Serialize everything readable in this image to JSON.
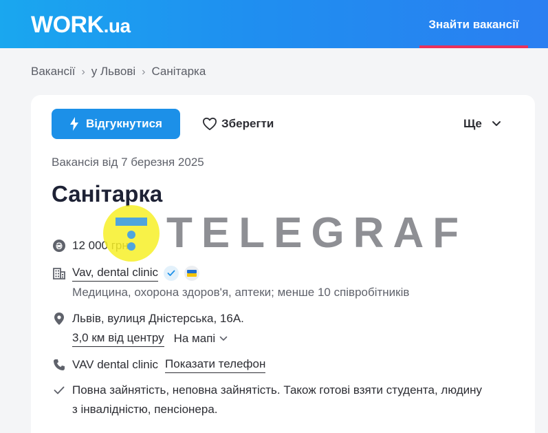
{
  "header": {
    "logo_main": "WORK",
    "logo_suffix": ".ua",
    "nav_find": "Знайти вакансії",
    "accent_color": "#e8315b"
  },
  "breadcrumb": {
    "items": [
      "Вакансії",
      "у Львові",
      "Санітарка"
    ],
    "separator": "›"
  },
  "actions": {
    "apply_label": "Відгукнутися",
    "save_label": "Зберегти",
    "more_label": "Ще"
  },
  "vacancy": {
    "posted": "Вакансія від 7 березня 2025",
    "title": "Санітарка",
    "salary": "12 000 грн",
    "company": "Vav, dental clinic",
    "company_info": "Медицина, охорона здоров'я, аптеки; менше 10 співробітників",
    "address": "Львів, вулиця Дністерська, 16А.",
    "distance": "3,0 км від центру",
    "map_label": "На мапі",
    "contact_name": "VAV dental clinic",
    "show_phone": "Показати телефон",
    "employment_line1": "Повна зайнятість, неповна зайнятість. Також готові взяти студента, людину",
    "employment_line2": "з інвалідністю, пенсіонера."
  },
  "watermark": {
    "text": "TELEGRAF"
  },
  "colors": {
    "primary_blue": "#1c90e8",
    "header_gradient_start": "#1aa7ef",
    "header_gradient_end": "#2a7ff1"
  }
}
